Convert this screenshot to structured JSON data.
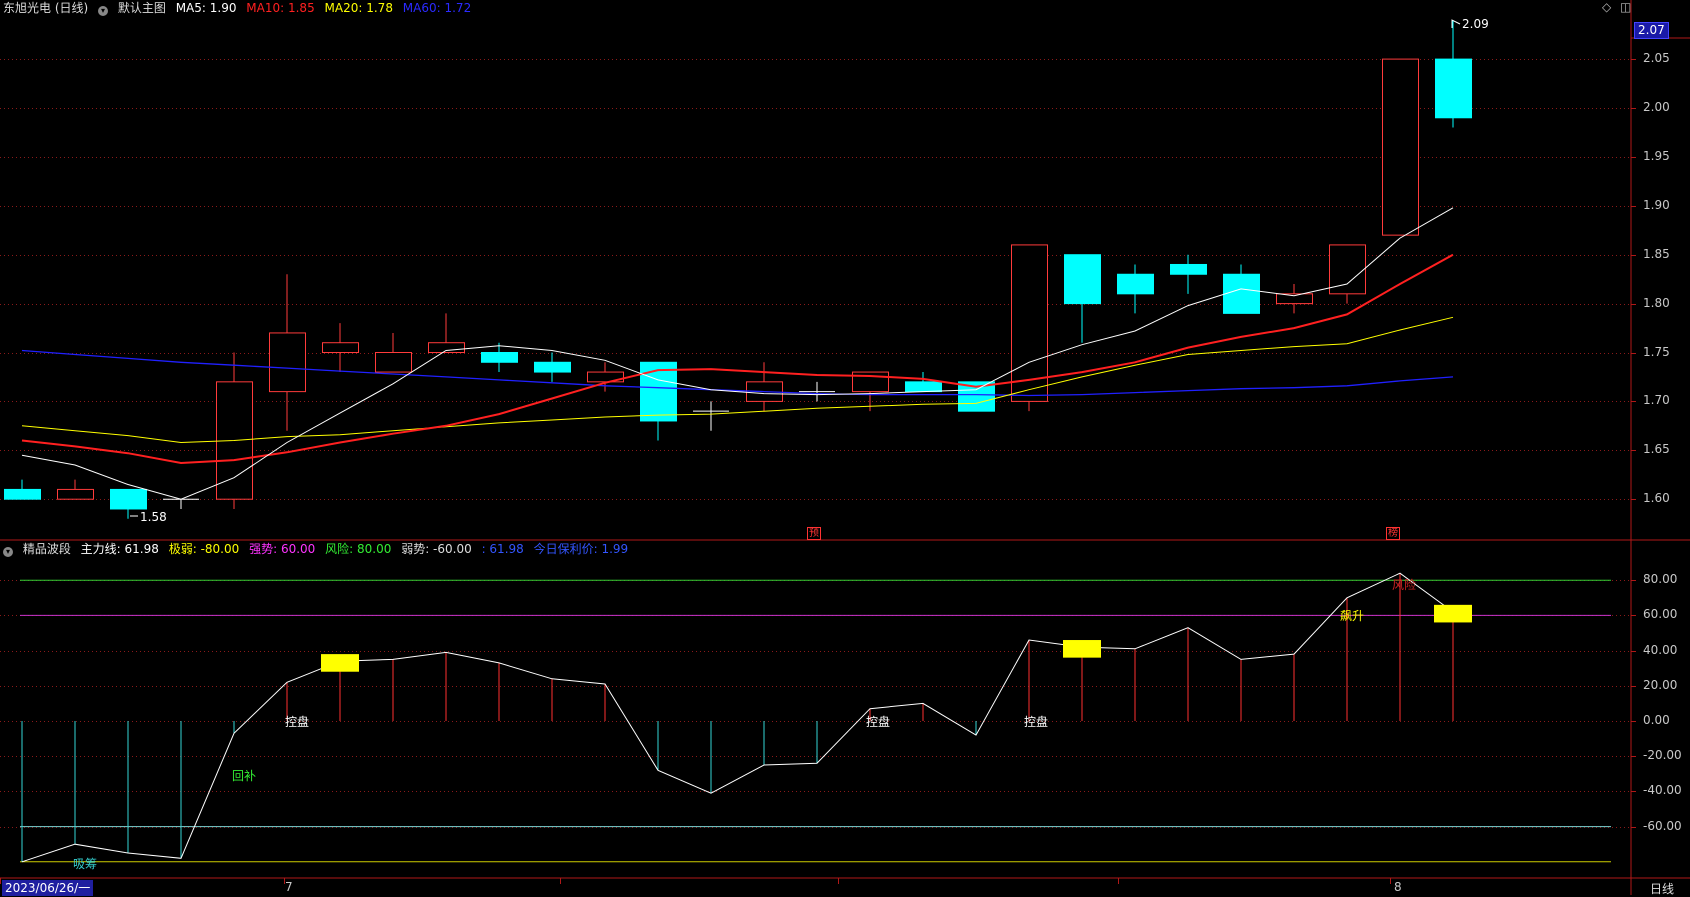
{
  "header": {
    "stock": "东旭光电 (日线)",
    "main_chart_label": "默认主图",
    "ma5": "MA5: 1.90",
    "ma10": "MA10: 1.85",
    "ma20": "MA20: 1.78",
    "ma60": "MA60: 1.72"
  },
  "indicator_header": {
    "name": "精品波段",
    "main_line": "主力线: 61.98",
    "weak_extreme": "极弱: -80.00",
    "strong": "强势: 60.00",
    "risk": "风险: 80.00",
    "weak": "弱势: -60.00",
    "value": ": 61.98",
    "today_cost": "今日保利价: 1.99"
  },
  "price_axis": {
    "ticks": [
      "2.05",
      "2.00",
      "1.95",
      "1.90",
      "1.85",
      "1.80",
      "1.75",
      "1.70",
      "1.65",
      "1.60"
    ],
    "current_price": "2.07"
  },
  "indicator_axis": {
    "ticks": [
      "80.00",
      "60.00",
      "40.00",
      "20.00",
      "0.00",
      "-20.00",
      "-40.00",
      "-60.00"
    ]
  },
  "date_axis": {
    "start_date": "2023/06/26/一",
    "month_7": "7",
    "month_8": "8",
    "period_button": "日线"
  },
  "price_annotations": {
    "high": "2.09",
    "low": "1.58",
    "marker_1": "预",
    "marker_2": "榜"
  },
  "indicator_annotations": {
    "xichou": "吸筹",
    "huibu": "回补",
    "kongpan_1": "控盘",
    "kongpan_2": "控盘",
    "kongpan_3": "控盘",
    "piaosheng": "飙升",
    "fengxian": "风险"
  },
  "colors": {
    "up": "#ff3b3b",
    "down": "#00ffff",
    "ma5": "#ffffff",
    "ma10": "#ff2020",
    "ma20": "#ffff00",
    "ma60": "#2020ff",
    "strong_line": "#cc33cc",
    "risk_line": "#33cc33",
    "weak_line": "#7fd6d6",
    "extreme_weak_line": "#cccc00"
  },
  "chart_data": {
    "type": "candlestick",
    "ylim": [
      1.56,
      2.1
    ],
    "candles": [
      {
        "o": 1.61,
        "h": 1.62,
        "l": 1.6,
        "c": 1.6
      },
      {
        "o": 1.6,
        "h": 1.62,
        "l": 1.6,
        "c": 1.61
      },
      {
        "o": 1.61,
        "h": 1.61,
        "l": 1.58,
        "c": 1.59
      },
      {
        "o": 1.6,
        "h": 1.6,
        "l": 1.59,
        "c": 1.6
      },
      {
        "o": 1.6,
        "h": 1.75,
        "l": 1.59,
        "c": 1.72
      },
      {
        "o": 1.71,
        "h": 1.83,
        "l": 1.67,
        "c": 1.77
      },
      {
        "o": 1.75,
        "h": 1.78,
        "l": 1.73,
        "c": 1.76
      },
      {
        "o": 1.73,
        "h": 1.77,
        "l": 1.73,
        "c": 1.75
      },
      {
        "o": 1.75,
        "h": 1.79,
        "l": 1.75,
        "c": 1.76
      },
      {
        "o": 1.75,
        "h": 1.76,
        "l": 1.73,
        "c": 1.74
      },
      {
        "o": 1.74,
        "h": 1.75,
        "l": 1.72,
        "c": 1.73
      },
      {
        "o": 1.72,
        "h": 1.74,
        "l": 1.71,
        "c": 1.73
      },
      {
        "o": 1.74,
        "h": 1.74,
        "l": 1.66,
        "c": 1.68
      },
      {
        "o": 1.69,
        "h": 1.7,
        "l": 1.67,
        "c": 1.69
      },
      {
        "o": 1.7,
        "h": 1.74,
        "l": 1.69,
        "c": 1.72
      },
      {
        "o": 1.71,
        "h": 1.72,
        "l": 1.7,
        "c": 1.71
      },
      {
        "o": 1.71,
        "h": 1.73,
        "l": 1.69,
        "c": 1.73
      },
      {
        "o": 1.72,
        "h": 1.73,
        "l": 1.71,
        "c": 1.71
      },
      {
        "o": 1.72,
        "h": 1.72,
        "l": 1.69,
        "c": 1.69
      },
      {
        "o": 1.7,
        "h": 1.86,
        "l": 1.69,
        "c": 1.86
      },
      {
        "o": 1.85,
        "h": 1.85,
        "l": 1.76,
        "c": 1.8
      },
      {
        "o": 1.83,
        "h": 1.84,
        "l": 1.79,
        "c": 1.81
      },
      {
        "o": 1.84,
        "h": 1.85,
        "l": 1.81,
        "c": 1.83
      },
      {
        "o": 1.83,
        "h": 1.84,
        "l": 1.79,
        "c": 1.79
      },
      {
        "o": 1.8,
        "h": 1.82,
        "l": 1.79,
        "c": 1.81
      },
      {
        "o": 1.81,
        "h": 1.86,
        "l": 1.8,
        "c": 1.86
      },
      {
        "o": 1.87,
        "h": 2.05,
        "l": 1.87,
        "c": 2.05
      },
      {
        "o": 2.05,
        "h": 2.09,
        "l": 1.98,
        "c": 1.99
      }
    ],
    "ma5": [
      1.645,
      1.635,
      1.615,
      1.6,
      1.622,
      1.658,
      1.688,
      1.718,
      1.752,
      1.757,
      1.752,
      1.742,
      1.722,
      1.712,
      1.708,
      1.707,
      1.708,
      1.71,
      1.712,
      1.74,
      1.758,
      1.772,
      1.798,
      1.815,
      1.808,
      1.82,
      1.867,
      1.898
    ],
    "ma10": [
      1.66,
      1.654,
      1.647,
      1.637,
      1.64,
      1.648,
      1.658,
      1.667,
      1.675,
      1.687,
      1.703,
      1.719,
      1.732,
      1.733,
      1.73,
      1.727,
      1.726,
      1.723,
      1.715,
      1.722,
      1.73,
      1.74,
      1.755,
      1.766,
      1.775,
      1.789,
      1.82,
      1.85
    ],
    "ma20": [
      1.675,
      1.67,
      1.665,
      1.658,
      1.66,
      1.664,
      1.666,
      1.67,
      1.674,
      1.678,
      1.681,
      1.684,
      1.686,
      1.687,
      1.69,
      1.693,
      1.695,
      1.697,
      1.698,
      1.712,
      1.725,
      1.737,
      1.748,
      1.752,
      1.756,
      1.759,
      1.773,
      1.786
    ],
    "ma60": [
      1.752,
      1.748,
      1.744,
      1.74,
      1.737,
      1.734,
      1.731,
      1.728,
      1.725,
      1.722,
      1.719,
      1.716,
      1.714,
      1.712,
      1.71,
      1.708,
      1.707,
      1.707,
      1.707,
      1.706,
      1.707,
      1.709,
      1.711,
      1.713,
      1.714,
      1.716,
      1.721,
      1.725
    ],
    "indicator": {
      "ylim": [
        -82,
        100
      ],
      "main_line": [
        -80,
        -70,
        -75,
        -78,
        -7,
        22,
        34,
        35,
        39,
        33,
        24,
        21,
        -28,
        -41,
        -25,
        -24,
        7,
        10,
        -8,
        46,
        42,
        41,
        53,
        35,
        38,
        70,
        84,
        62
      ],
      "levels": {
        "risk": 80,
        "strong": 60,
        "weak": -60,
        "extreme_weak": -80
      },
      "yellow_bars": [
        {
          "i": 6,
          "lo": 28,
          "hi": 38
        },
        {
          "i": 20,
          "lo": 36,
          "hi": 46
        },
        {
          "i": 27,
          "lo": 56,
          "hi": 66
        }
      ]
    }
  }
}
